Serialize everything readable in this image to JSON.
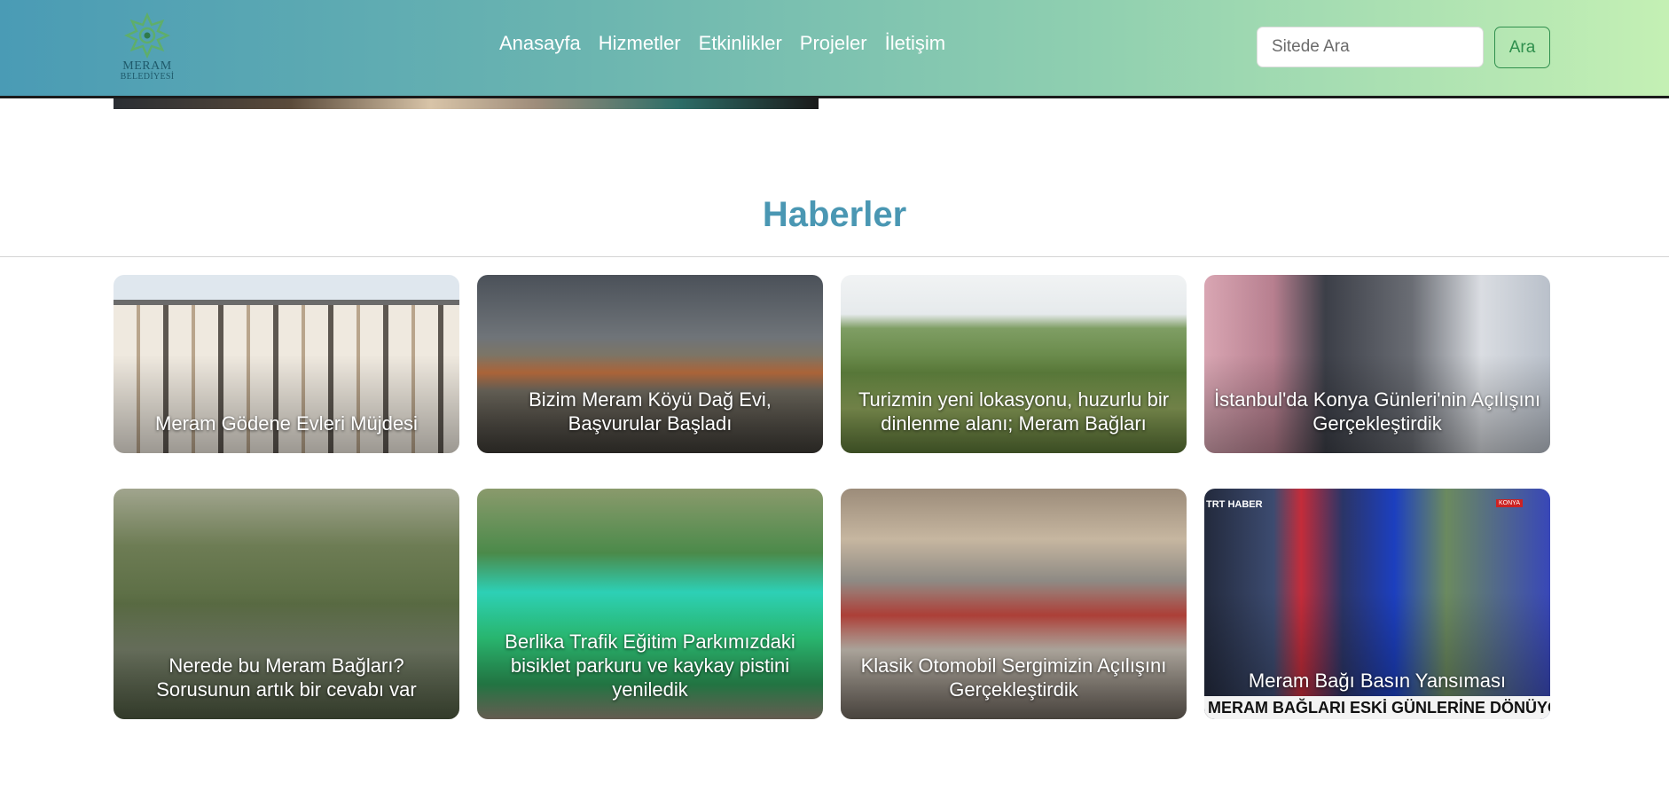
{
  "brand": {
    "name": "MERAM",
    "subtitle": "BELEDİYESİ"
  },
  "nav": {
    "links": [
      "Anasayfa",
      "Hizmetler",
      "Etkinlikler",
      "Projeler",
      "İletişim"
    ]
  },
  "search": {
    "placeholder": "Sitede Ara",
    "value": "",
    "button_label": "Ara"
  },
  "news": {
    "title": "Haberler",
    "items": [
      {
        "title": "Meram Gödene Evleri Müjdesi"
      },
      {
        "title": "Bizim Meram Köyü Dağ Evi, Başvurular Başladı"
      },
      {
        "title": "Turizmin yeni lokasyonu, huzurlu bir dinlenme alanı; Meram Bağları"
      },
      {
        "title": "İstanbul'da Konya Günleri'nin Açılışını Gerçekleştirdik"
      },
      {
        "title": "Nerede bu Meram Bağları? Sorusunun artık bir cevabı var"
      },
      {
        "title": "Berlika Trafik Eğitim Parkımızdaki bisiklet parkuru ve kaykay pistini yeniledik"
      },
      {
        "title": "Klasik Otomobil Sergimizin Açılışını Gerçekleştirdik"
      },
      {
        "title": "Meram Bağı Basın Yansıması"
      }
    ],
    "image_texts": {
      "ticker": "MERAM BAĞLARI ESKİ GÜNLERİNE DÖNÜYOR",
      "channel": "TRT HABER",
      "tag": "KONYA"
    }
  },
  "colors": {
    "accent": "#4a97b3",
    "button": "#2f8f4d",
    "header_start": "#4a9bb5",
    "header_end": "#c4f0b4"
  }
}
